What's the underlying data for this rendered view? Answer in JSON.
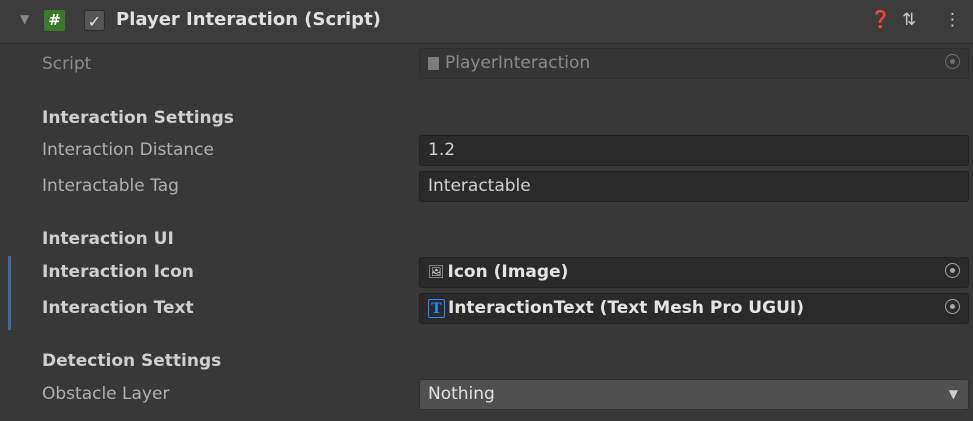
{
  "header": {
    "title": "Player Interaction (Script)",
    "enabled_check": "✓",
    "script_icon_glyph": "#",
    "collapse_glyph": "▼",
    "help_glyph": "❓",
    "presets_glyph": "⇅",
    "menu_glyph": "⋮"
  },
  "script_row": {
    "label": "Script",
    "value": "PlayerInteraction"
  },
  "sections": {
    "interaction_settings": {
      "heading": "Interaction Settings",
      "distance": {
        "label": "Interaction Distance",
        "value": "1.2"
      },
      "tag": {
        "label": "Interactable Tag",
        "value": "Interactable"
      }
    },
    "interaction_ui": {
      "heading": "Interaction UI",
      "icon": {
        "label": "Interaction Icon",
        "value": "Icon (Image)",
        "icon_glyph": "🖼"
      },
      "text": {
        "label": "Interaction Text",
        "value": "InteractionText (Text Mesh Pro UGUI)",
        "icon_glyph": "T"
      }
    },
    "detection_settings": {
      "heading": "Detection Settings",
      "obstacle_layer": {
        "label": "Obstacle Layer",
        "value": "Nothing"
      }
    }
  },
  "colors": {
    "background": "#383838",
    "field_bg": "#2a2a2a",
    "accent": "#3b6c99",
    "script_icon": "#3a7a2a",
    "tmp_icon": "#1e90ff"
  }
}
